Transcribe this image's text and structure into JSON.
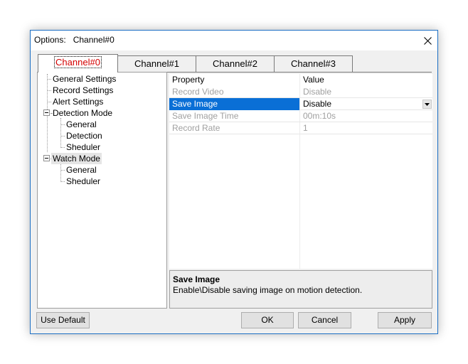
{
  "window": {
    "title": "Options:   Channel#0"
  },
  "tabs": [
    {
      "label": "Channel#0",
      "active": true
    },
    {
      "label": "Channel#1",
      "active": false
    },
    {
      "label": "Channel#2",
      "active": false
    },
    {
      "label": "Channel#3",
      "active": false
    }
  ],
  "tree": {
    "items": [
      {
        "label": "General Settings"
      },
      {
        "label": "Record Settings"
      },
      {
        "label": "Alert Settings"
      },
      {
        "label": "Detection Mode"
      },
      {
        "label": "General"
      },
      {
        "label": "Detection"
      },
      {
        "label": "Sheduler"
      },
      {
        "label": "Watch Mode"
      },
      {
        "label": "General"
      },
      {
        "label": "Sheduler"
      }
    ]
  },
  "grid": {
    "headers": {
      "property": "Property",
      "value": "Value"
    },
    "rows": [
      {
        "property": "Record Video",
        "value": "Disable",
        "enabled": false,
        "selected": false
      },
      {
        "property": "Save Image",
        "value": "Disable",
        "enabled": true,
        "selected": true
      },
      {
        "property": "Save Image Time",
        "value": "00m:10s",
        "enabled": false,
        "selected": false
      },
      {
        "property": "Record Rate",
        "value": "1",
        "enabled": false,
        "selected": false
      }
    ]
  },
  "description": {
    "title": "Save Image",
    "text": "Enable\\Disable saving image on motion detection."
  },
  "buttons": {
    "use_default": "Use Default",
    "ok": "OK",
    "cancel": "Cancel",
    "apply": "Apply"
  },
  "icons": {
    "close": "close-icon",
    "dropdown": "chevron-down-icon"
  },
  "colors": {
    "active_tab_text": "#d40000",
    "selection": "#0a6fd6",
    "window_border": "#1c6fc4"
  }
}
